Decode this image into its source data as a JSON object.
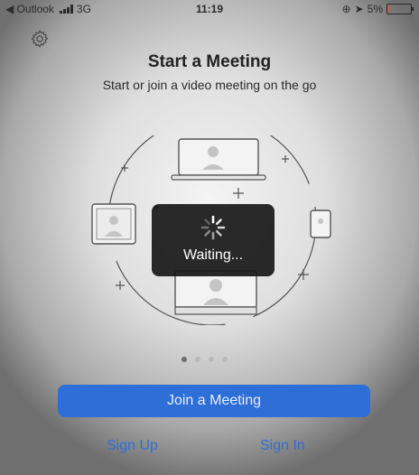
{
  "status_bar": {
    "back_app": "◀ Outlook",
    "network": "3G",
    "time": "11:19",
    "battery": "5%",
    "battery_level": 0.05
  },
  "header": {
    "settings_icon": "gear-icon",
    "title": "Start a Meeting",
    "subtitle": "Start or join a video meeting on the go"
  },
  "illustration": {
    "devices": [
      "laptop",
      "monitor",
      "tablet",
      "phone"
    ]
  },
  "overlay": {
    "text": "Waiting..."
  },
  "pager": {
    "count": 4,
    "active": 0
  },
  "actions": {
    "join_label": "Join a Meeting",
    "sign_up_label": "Sign Up",
    "sign_in_label": "Sign In"
  },
  "colors": {
    "accent": "#2d6fd6",
    "battery_low": "#e8452c"
  }
}
